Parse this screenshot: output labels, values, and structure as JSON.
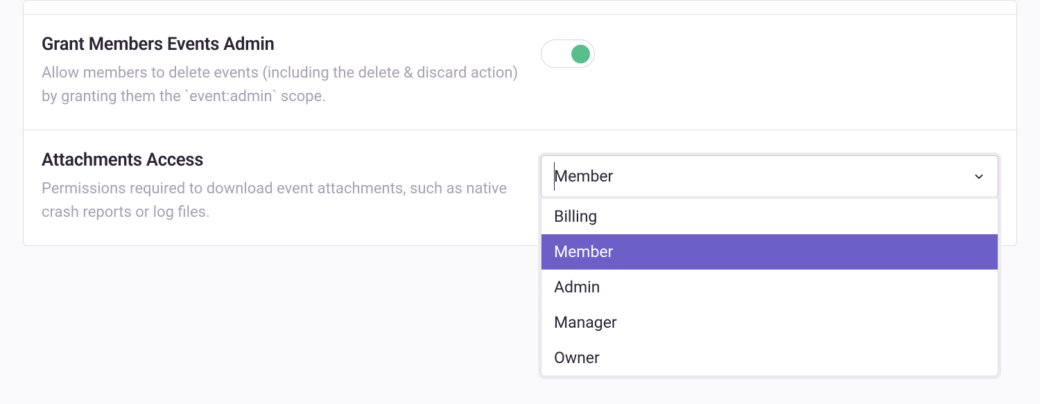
{
  "settings": {
    "grant_members_events_admin": {
      "title": "Grant Members Events Admin",
      "description": "Allow members to delete events (including the delete & discard action) by granting them the `event:admin` scope.",
      "enabled": true
    },
    "attachments_access": {
      "title": "Attachments Access",
      "description": "Permissions required to download event attachments, such as native crash reports or log files.",
      "selected": "Member",
      "options": [
        "Billing",
        "Member",
        "Admin",
        "Manager",
        "Owner"
      ]
    }
  },
  "colors": {
    "accent": "#6c5fc7",
    "toggle_on": "#57be8c"
  }
}
